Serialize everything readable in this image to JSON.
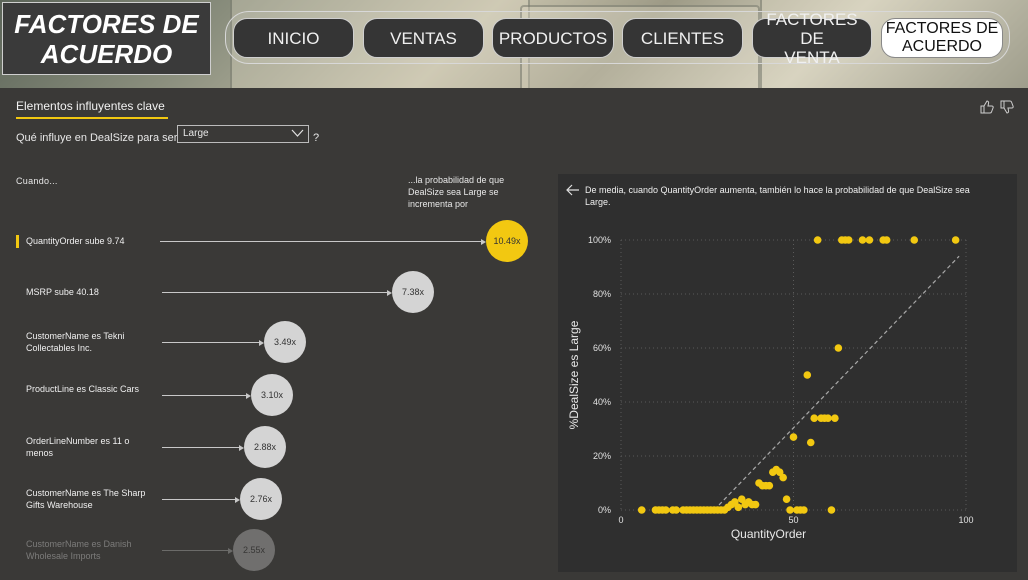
{
  "header": {
    "title": "FACTORES DE\nACUERDO",
    "nav": [
      {
        "label": "INICIO",
        "active": false
      },
      {
        "label": "VENTAS",
        "active": false
      },
      {
        "label": "PRODUCTOS",
        "active": false
      },
      {
        "label": "CLIENTES",
        "active": false
      },
      {
        "label": "FACTORES DE\nVENTA",
        "active": false
      },
      {
        "label": "FACTORES DE\nACUERDO",
        "active": true
      }
    ]
  },
  "visual": {
    "title": "Elementos influyentes clave",
    "question_prefix": "Qué influye en DealSize para ser",
    "dropdown_value": "Large",
    "question_suffix": "?",
    "when_label": "Cuando...",
    "prob_label": "...la probabilidad de que DealSize sea Large se incrementa por",
    "factors": [
      {
        "label": "QuantityOrder sube 9.74",
        "value": "10.49x",
        "highlighted": true
      },
      {
        "label": "MSRP sube 40.18",
        "value": "7.38x",
        "highlighted": false
      },
      {
        "label": "CustomerName es Tekni Collectables Inc.",
        "value": "3.49x",
        "highlighted": false
      },
      {
        "label": "ProductLine es Classic Cars",
        "value": "3.10x",
        "highlighted": false
      },
      {
        "label": "OrderLineNumber es 11 o menos",
        "value": "2.88x",
        "highlighted": false
      },
      {
        "label": "CustomerName es The Sharp Gifts Warehouse",
        "value": "2.76x",
        "highlighted": false
      },
      {
        "label": "CustomerName es Danish Wholesale Imports",
        "value": "2.55x",
        "highlighted": false
      }
    ],
    "colors": {
      "accent": "#f2c811",
      "circle": "#d4d4d4",
      "background": "#3a3937"
    },
    "icons": [
      "thumbs-up-icon",
      "thumbs-down-icon",
      "chevron-down-icon",
      "back-arrow-icon"
    ]
  },
  "chart_note": "De media, cuando QuantityOrder aumenta, también lo hace la probabilidad de que DealSize sea Large.",
  "chart_data": {
    "type": "scatter",
    "xlabel": "QuantityOrder",
    "ylabel": "%DealSize es Large",
    "xlim": [
      0,
      100
    ],
    "ylim": [
      0,
      100
    ],
    "x_ticks": [
      0,
      50,
      100
    ],
    "x_tick_labels": [
      "0",
      "50",
      "100"
    ],
    "y_ticks": [
      0,
      20,
      40,
      60,
      80,
      100
    ],
    "y_tick_labels": [
      "0%",
      "20%",
      "40%",
      "60%",
      "80%",
      "100%"
    ],
    "grid": true,
    "trend_line": {
      "x": [
        27,
        98
      ],
      "y": [
        0,
        94
      ]
    },
    "series": [
      {
        "color": "#f2c811",
        "x": [
          6,
          10,
          11,
          12,
          13,
          15,
          16,
          18,
          19,
          20,
          21,
          22,
          23,
          24,
          25,
          26,
          27,
          28,
          29,
          30,
          31,
          32,
          33,
          34,
          35,
          36,
          37,
          38,
          39,
          40,
          41,
          42,
          43,
          44,
          45,
          46,
          47,
          48,
          49,
          50,
          51,
          52,
          53,
          54,
          55,
          56,
          57,
          58,
          59,
          60,
          61,
          62,
          63,
          64,
          65,
          66,
          70,
          72,
          76,
          77,
          85,
          97
        ],
        "y": [
          0,
          0,
          0,
          0,
          0,
          0,
          0,
          0,
          0,
          0,
          0,
          0,
          0,
          0,
          0,
          0,
          0,
          0,
          0,
          0,
          1,
          2,
          3,
          1,
          4,
          2,
          3,
          2,
          2,
          10,
          9,
          9,
          9,
          14,
          15,
          14,
          12,
          4,
          0,
          27,
          0,
          0,
          0,
          50,
          25,
          34,
          100,
          34,
          34,
          34,
          0,
          34,
          60,
          100,
          100,
          100,
          100,
          100,
          100,
          100,
          100,
          100
        ]
      }
    ]
  }
}
